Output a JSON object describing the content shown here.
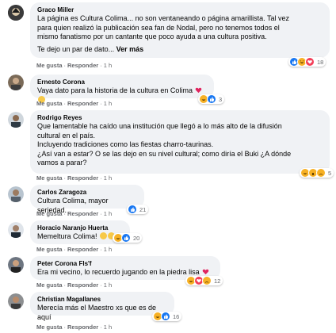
{
  "comments": [
    {
      "author": "Graco Miller",
      "lines": [
        "La página es Cultura Colima... no son ventaneando o página amarillista. Tal vez",
        "para quien realizó la publicación sea fan de Nodal, pero no tenemos todos el",
        "mismo fanatismo por un cantante que poco ayuda a una cultura positiva."
      ],
      "lines2": "Te dejo un par de dato...",
      "more": "Ver más",
      "like": "Me gusta",
      "reply": "Responder",
      "time": "1 h",
      "reactions": [
        "like",
        "haha",
        "love"
      ],
      "reaction_count": "18"
    },
    {
      "author": "Ernesto Corona",
      "lines": [
        "Vaya dato para la historia de la cultura en Colima"
      ],
      "emojis": [
        "heart",
        "clap"
      ],
      "like": "Me gusta",
      "reply": "Responder",
      "time": "1 h",
      "reactions": [
        "haha",
        "like"
      ],
      "reaction_count": "3"
    },
    {
      "author": "Rodrigo Reyes",
      "lines": [
        "Que lamentable ha caído una institución que llegó a lo más alto de la difusión",
        "cultural en el país.",
        "Incluyendo tradiciones como las fiestas charro-taurinas.",
        "¿Así van a estar? O se las dejo en su nivel cultural; como diría el Buki ¿A dónde",
        "vamos a parar?"
      ],
      "like": "Me gusta",
      "reply": "Responder",
      "time": "1 h",
      "reactions": [
        "haha",
        "wow",
        "sad"
      ],
      "reaction_count": "5"
    },
    {
      "author": "Carlos Zaragoza",
      "lines": [
        "Cultura Colima, mayor seriedad."
      ],
      "like": "Me gusta",
      "reply": "Responder",
      "time": "1 h",
      "reactions": [
        "like"
      ],
      "reaction_count": "21"
    },
    {
      "author": "Horacio Naranjo Huerta",
      "lines": [
        "Memeltura Colima!"
      ],
      "emojis": [
        "laugh",
        "laugh"
      ],
      "like": "Me gusta",
      "reply": "Responder",
      "time": "1 h",
      "reactions": [
        "haha",
        "like"
      ],
      "reaction_count": "20"
    },
    {
      "author": "Peter Corona Fls'f",
      "lines": [
        "Era mi vecino, lo recuerdo jugando en la piedra lisa"
      ],
      "emojis": [
        "heart"
      ],
      "like": "Me gusta",
      "reply": "Responder",
      "time": "1 h",
      "reactions": [
        "haha",
        "love",
        "sad"
      ],
      "reaction_count": "12"
    },
    {
      "author": "Christian Magallanes",
      "lines": [
        "Merecía más el Maestro xs que es de aquí"
      ],
      "like": "Me gusta",
      "reply": "Responder",
      "time": "1 h",
      "reactions": [
        "haha",
        "like"
      ],
      "reaction_count": "16"
    }
  ],
  "colors": {
    "like": "#1877f2",
    "love": "#f33e58",
    "haha": "#f7b125",
    "bubble": "#f0f2f5",
    "meta": "#65676b"
  }
}
